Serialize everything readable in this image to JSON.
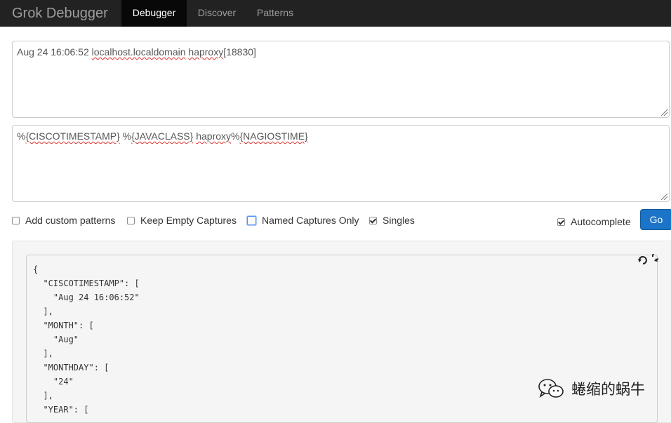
{
  "navbar": {
    "brand": "Grok Debugger",
    "tabs": [
      {
        "label": "Debugger",
        "active": true
      },
      {
        "label": "Discover",
        "active": false
      },
      {
        "label": "Patterns",
        "active": false
      }
    ]
  },
  "input": {
    "parts": [
      "Aug 24 16:06:52 ",
      "localhost.localdomain",
      " ",
      "haproxy",
      "[18830]"
    ]
  },
  "pattern": {
    "parts": [
      "%",
      "{CISCOTIMESTAMP}",
      " %",
      "{JAVACLASS}",
      " ",
      "haproxy",
      "%",
      "{NAGIOSTIME}"
    ]
  },
  "options": {
    "add_custom_patterns": {
      "label": "Add custom patterns",
      "checked": false
    },
    "keep_empty_captures": {
      "label": "Keep Empty Captures",
      "checked": false
    },
    "named_captures_only": {
      "label": "Named Captures Only",
      "checked": false
    },
    "singles": {
      "label": "Singles",
      "checked": true
    },
    "autocomplete": {
      "label": "Autocomplete",
      "checked": true
    }
  },
  "go_button": {
    "label": "Go"
  },
  "output": {
    "lines": [
      "{",
      "  \"CISCOTIMESTAMP\": [",
      "    \"Aug 24 16:06:52\"",
      "  ],",
      "  \"MONTH\": [",
      "    \"Aug\"",
      "  ],",
      "  \"MONTHDAY\": [",
      "    \"24\"",
      "  ],",
      "  \"YEAR\": ["
    ]
  },
  "watermark": {
    "text": "蜷缩的蜗牛",
    "icon": "wechat-icon"
  },
  "colors": {
    "navbar_bg": "#222222",
    "go_button_bg": "#1b74c8"
  }
}
